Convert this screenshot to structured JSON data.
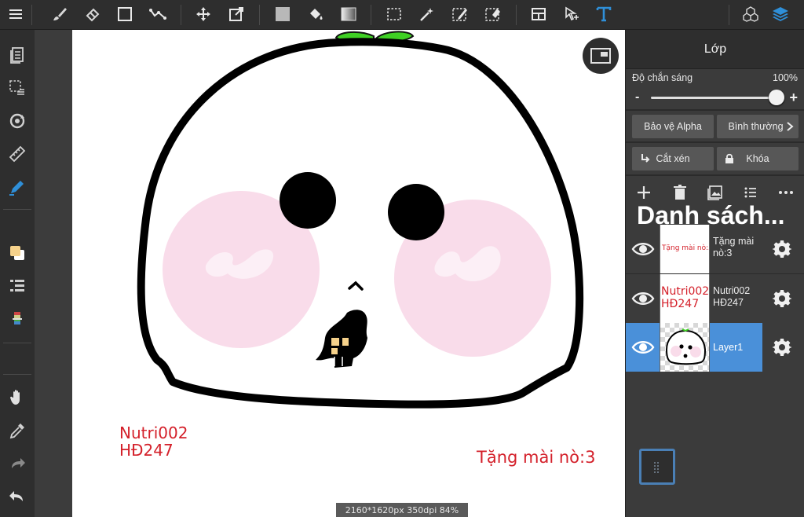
{
  "colors": {
    "accent": "#4a90d9",
    "toolbar_bg": "#2e2e2e",
    "panel_bg": "#3b3b3b",
    "canvas_bg": "#ffffff",
    "red_text": "#d4202a",
    "layer_icon_blue": "#2f8fd8",
    "blush_pink": "#f9dcea"
  },
  "toolbar": {
    "items": [
      "menu-icon",
      "brush-icon",
      "eraser-icon",
      "rectangle-icon",
      "smudge-icon",
      "move-icon",
      "transform-icon",
      "fill-color-icon",
      "bucket-icon",
      "gradient-icon",
      "select-rect-icon",
      "magic-wand-icon",
      "select-pen-icon",
      "select-eraser-icon",
      "layout-icon",
      "select-pointer-icon",
      "text-icon",
      "3d-icon",
      "layers-icon"
    ]
  },
  "leftbar": {
    "items": [
      "pages-icon",
      "selection-list-icon",
      "rotate-icon",
      "ruler-icon",
      "pen-tool-icon",
      "color-swatch-icon",
      "layer-list-icon",
      "color-slider-icon",
      "hand-icon",
      "eyedropper-icon",
      "redo-icon",
      "undo-icon"
    ]
  },
  "canvas": {
    "text_left_line1": "Nutri002",
    "text_left_line2": "HĐ247",
    "text_right": "Tặng mài nò:3",
    "status": "2160*1620px 350dpi 84%"
  },
  "panel": {
    "title": "Lớp",
    "opacity_label": "Độ chắn sáng",
    "opacity_value": "100%",
    "opacity": 1.0,
    "slider_minus": "-",
    "slider_plus": "+",
    "alpha_protect": "Bảo vệ Alpha",
    "blend_mode": "Bình thường",
    "clip": "Cắt xén",
    "lock": "Khóa",
    "list_title": "Danh sách...",
    "layers": [
      {
        "name": "Tặng mài nò:3",
        "thumb_text": "Tặng mài nò:3",
        "selected": false
      },
      {
        "name": "Nutri002 HĐ247",
        "thumb_line1": "Nutri002",
        "thumb_line2": "HĐ247",
        "selected": false
      },
      {
        "name": "Layer1",
        "selected": true
      }
    ]
  }
}
